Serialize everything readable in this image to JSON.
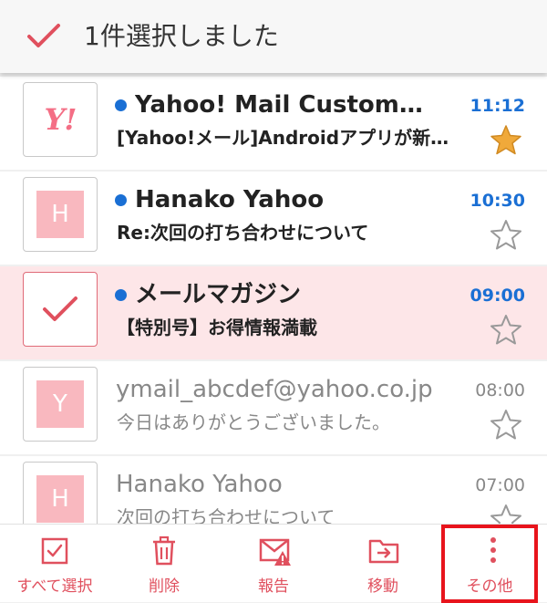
{
  "header": {
    "title": "1件選択しました"
  },
  "messages": [
    {
      "sender": "Yahoo! Mail Customer Service",
      "subject": "[Yahoo!メール]Androidアプリが新しくなりました",
      "time": "11:12",
      "unread": true,
      "selected": false,
      "starred": true,
      "avatar": "Y!"
    },
    {
      "sender": "Hanako Yahoo",
      "subject": "Re:次回の打ち合わせについて",
      "time": "10:30",
      "unread": true,
      "selected": false,
      "starred": false,
      "avatar": "H"
    },
    {
      "sender": "メールマガジン",
      "subject": "【特別号】お得情報満載",
      "time": "09:00",
      "unread": true,
      "selected": true,
      "starred": false,
      "avatar": ""
    },
    {
      "sender": "ymail_abcdef@yahoo.co.jp",
      "subject": "今日はありがとうございました。",
      "time": "08:00",
      "unread": false,
      "selected": false,
      "starred": false,
      "avatar": "Y"
    },
    {
      "sender": "Hanako Yahoo",
      "subject": "次回の打ち合わせについて",
      "time": "07:00",
      "unread": false,
      "selected": false,
      "starred": false,
      "avatar": "H"
    }
  ],
  "toolbar": {
    "select_all": "すべて選択",
    "delete": "削除",
    "report": "報告",
    "move": "移動",
    "more": "その他"
  },
  "colors": {
    "accent": "#e0505e",
    "unread_dot": "#1a6fd4",
    "selected_row": "#fde6e8",
    "avatar_bg": "#f9b8bf",
    "star": "#f0a93a",
    "highlight_box": "#e8141c"
  }
}
